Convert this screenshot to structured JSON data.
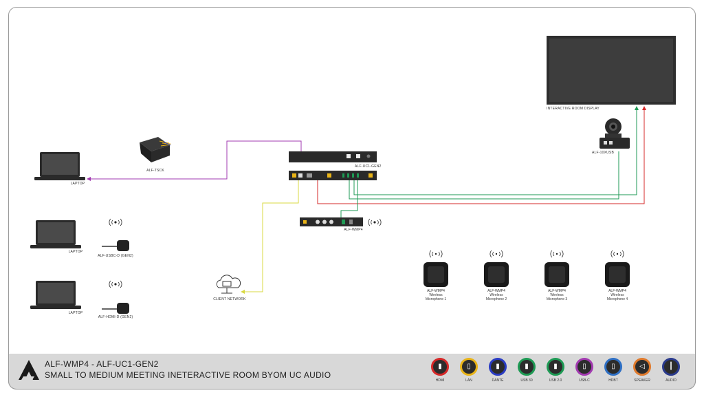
{
  "footer": {
    "title_line1": "ALF-WMP4 - ALF-UC1-GEN2",
    "title_line2": "SMALL TO MEDIUM MEETING INETERACTIVE ROOM BYOM UC AUDIO"
  },
  "devices": {
    "laptop_main": "LAPTOP",
    "laptop_usbc": "LAPTOP",
    "laptop_hdmi": "LAPTOP",
    "tsck": "ALF-TSCK",
    "usbc_dongle": "ALF-USBC-D (GEN2)",
    "hdmi_dongle": "ALF-HDMI-D (GEN2)",
    "uc1": "ALF-UC1-GEN2",
    "wmp4": "ALF-WMP4",
    "camera": "ALF-10XUSB",
    "display": "INTERACTIVE ROOM DISPLAY",
    "network": "CLIENT NETWORK"
  },
  "mics": [
    {
      "line1": "ALF-WMP4",
      "line2": "Wireless",
      "line3": "Microphone 1"
    },
    {
      "line1": "ALF-WMP4",
      "line2": "Wireless",
      "line3": "Microphone 2"
    },
    {
      "line1": "ALF-WMP4",
      "line2": "Wireless",
      "line3": "Microphone 3"
    },
    {
      "line1": "ALF-WMP4",
      "line2": "Wireless",
      "line3": "Microphone 4"
    }
  ],
  "legend": [
    {
      "label": "HDMI",
      "color": "#d62828",
      "icon": "hdmi-connector-icon"
    },
    {
      "label": "LAN",
      "color": "#e9b418",
      "icon": "lan-connector-icon"
    },
    {
      "label": "DANTE",
      "color": "#2a3cc4",
      "icon": "dante-connector-icon"
    },
    {
      "label": "USB 30",
      "color": "#1e9a54",
      "icon": "usb3-connector-icon"
    },
    {
      "label": "USB 2.0",
      "color": "#1e9a54",
      "icon": "usb2-connector-icon"
    },
    {
      "label": "USB-C",
      "color": "#a23ab0",
      "icon": "usbc-connector-icon"
    },
    {
      "label": "HDBT",
      "color": "#2e6fc4",
      "icon": "hdbt-connector-icon"
    },
    {
      "label": "SPEAKER",
      "color": "#e07a2c",
      "icon": "speaker-icon"
    },
    {
      "label": "AUDIO",
      "color": "#2a3a8c",
      "icon": "audio-connector-icon"
    }
  ]
}
